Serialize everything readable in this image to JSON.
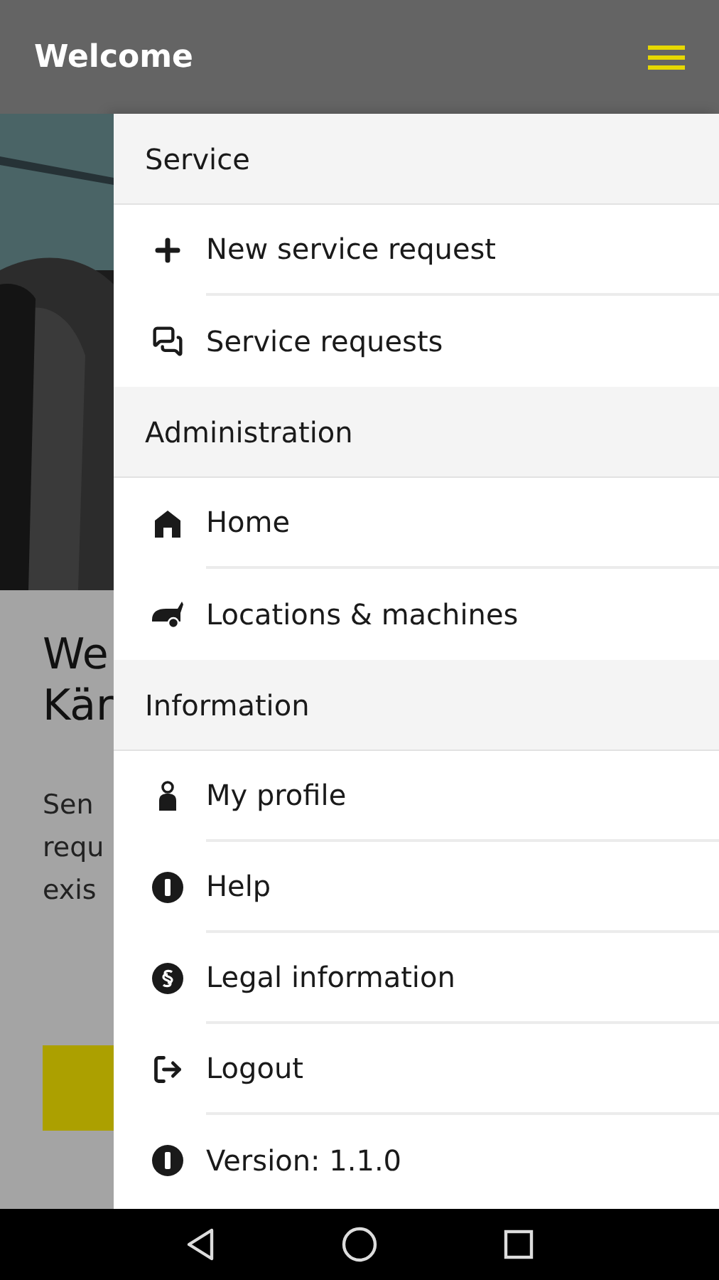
{
  "app_bar": {
    "title": "Welcome"
  },
  "background": {
    "heading_lines": [
      "We",
      "Kär"
    ],
    "body_lines": [
      "Sen",
      "requ",
      "exis"
    ]
  },
  "drawer": {
    "rows": [
      {
        "kind": "header",
        "label": "Service"
      },
      {
        "kind": "item",
        "label": "New service request"
      },
      {
        "kind": "item",
        "label": "Service requests"
      },
      {
        "kind": "header",
        "label": "Administration"
      },
      {
        "kind": "item",
        "label": "Home"
      },
      {
        "kind": "item",
        "label": "Locations & machines"
      },
      {
        "kind": "header",
        "label": "Information"
      },
      {
        "kind": "item",
        "label": "My profile"
      },
      {
        "kind": "item",
        "label": "Help"
      },
      {
        "kind": "item",
        "label": "Legal information"
      },
      {
        "kind": "item",
        "label": "Logout"
      },
      {
        "kind": "item",
        "label": "Version: 1.1.0"
      }
    ]
  }
}
